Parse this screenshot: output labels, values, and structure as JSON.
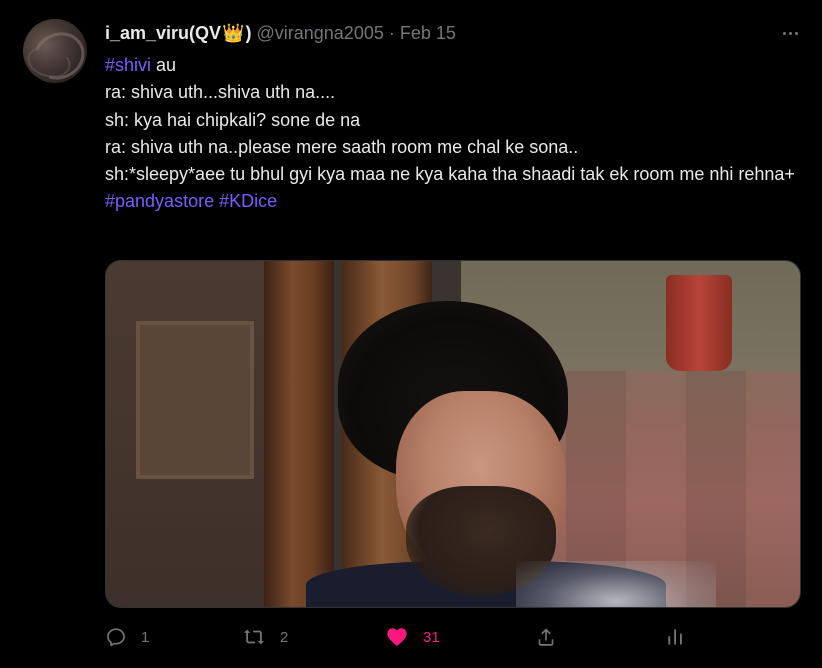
{
  "tweet": {
    "display_name": "i_am_viru(QV",
    "crown": "👑",
    "display_name_suffix": ")",
    "handle": "@virangna2005",
    "separator": "·",
    "date": "Feb 15",
    "more_icon": "more-horizontal-icon",
    "lines": [
      {
        "hashtag": "#shivi",
        "text": " au"
      },
      {
        "text": "ra: shiva uth...shiva uth na...."
      },
      {
        "text": "sh: kya hai chipkali? sone de na"
      },
      {
        "text": "ra: shiva uth na..please mere saath room me chal ke sona.."
      },
      {
        "text": "sh:*sleepy*aee tu bhul gyi kya maa ne kya kaha tha shaadi tak ek room me nhi rehna+"
      }
    ],
    "hashtags": [
      "#pandyastore",
      "#KDice"
    ],
    "media_alt": "GIF of a man with eyes closed leaning against a wooden pillar",
    "actions": {
      "reply": {
        "icon": "reply-icon",
        "count": "1"
      },
      "retweet": {
        "icon": "retweet-icon",
        "count": "2"
      },
      "like": {
        "icon": "heart-icon",
        "count": "31",
        "liked": true
      },
      "share": {
        "icon": "share-icon"
      },
      "analytics": {
        "icon": "analytics-icon"
      }
    }
  },
  "colors": {
    "background": "#000000",
    "text": "#e7e9ea",
    "muted": "#71767b",
    "hashtag": "#7c5cff",
    "like": "#f91880"
  }
}
